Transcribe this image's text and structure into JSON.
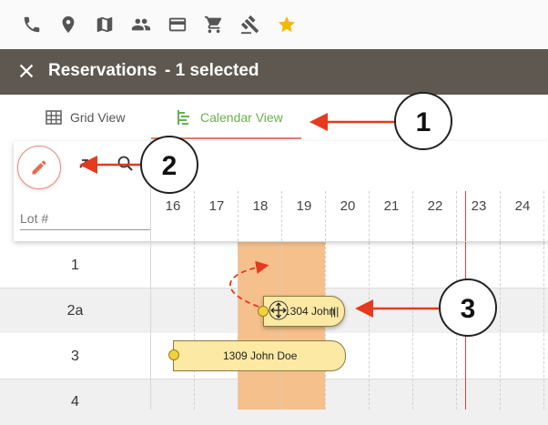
{
  "toolbar": {
    "icons": [
      "phone-icon",
      "location-pin-icon",
      "map-icon",
      "people-icon",
      "credit-card-icon",
      "cart-icon",
      "gavel-icon",
      "star-icon"
    ],
    "star_color": "#f5b800"
  },
  "header": {
    "close_icon": "close-icon",
    "title": "Reservations",
    "selection": "- 1 selected",
    "background": "#5e5850"
  },
  "tabs": [
    {
      "label": "Grid View",
      "icon": "grid-icon",
      "active": false
    },
    {
      "label": "Calendar View",
      "icon": "calendar-view-icon",
      "active": true
    }
  ],
  "calendar": {
    "lot_label": "Lot #",
    "columns": [
      "16",
      "17",
      "18",
      "19",
      "20",
      "21",
      "22",
      "23",
      "24"
    ],
    "rows": [
      "1",
      "2a",
      "3",
      "4"
    ],
    "reservations": [
      {
        "label": "1304 John",
        "suffix": "|||",
        "row": "2a",
        "state": "dragging"
      },
      {
        "label": "1309 John Doe",
        "row": "3",
        "state": "normal"
      }
    ],
    "accent": "#6ab04c",
    "highlight_color": "#f5c08c",
    "today_line_color": "#e04040"
  },
  "annotations": {
    "callout_1": "1",
    "callout_2": "2",
    "callout_3": "3",
    "arrow_color": "#e53a1e"
  }
}
